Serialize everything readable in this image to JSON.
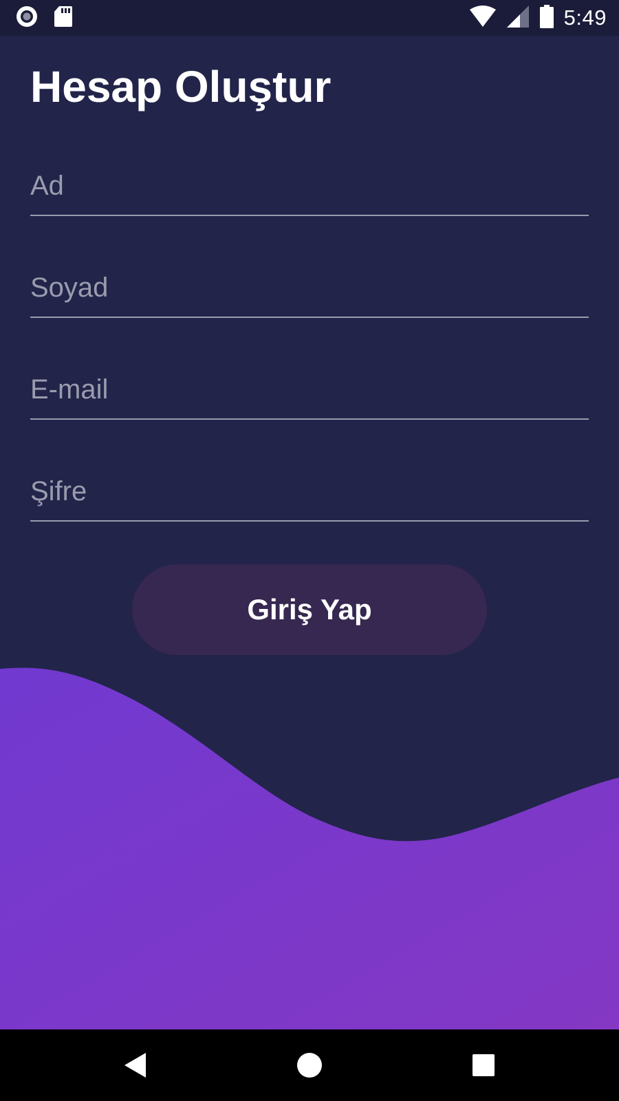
{
  "status_bar": {
    "time": "5:49",
    "icons": [
      "record-icon",
      "sd-card-icon",
      "wifi-icon",
      "cell-signal-icon",
      "battery-icon"
    ]
  },
  "page": {
    "title": "Hesap Oluştur"
  },
  "form": {
    "fields": [
      {
        "name": "first-name",
        "placeholder": "Ad",
        "value": ""
      },
      {
        "name": "last-name",
        "placeholder": "Soyad",
        "value": ""
      },
      {
        "name": "email",
        "placeholder": "E-mail",
        "value": ""
      },
      {
        "name": "password",
        "placeholder": "Şifre",
        "value": ""
      }
    ],
    "submit_label": "Giriş Yap"
  },
  "colors": {
    "background": "#22244a",
    "status_bar": "#1b1c39",
    "wave_start": "#7139d0",
    "wave_end": "#8438c4",
    "button": "#362850",
    "field_line": "#9a9cae",
    "nav_bar": "#000000"
  },
  "nav_bar": {
    "icons": [
      "back-icon",
      "home-icon",
      "recents-icon"
    ]
  }
}
